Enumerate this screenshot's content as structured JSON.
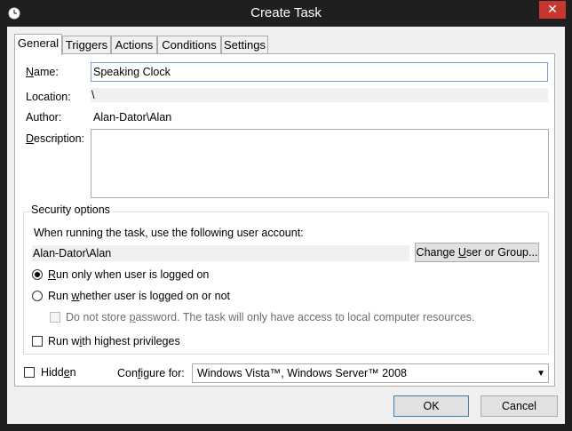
{
  "window": {
    "title": "Create Task",
    "close_glyph": "✕"
  },
  "tabs": [
    {
      "label": "General"
    },
    {
      "label": "Triggers"
    },
    {
      "label": "Actions"
    },
    {
      "label": "Conditions"
    },
    {
      "label": "Settings"
    }
  ],
  "general": {
    "name_label_u": "N",
    "name_label_rest": "ame:",
    "name_value": "Speaking Clock",
    "location_label": "Location:",
    "location_value": "\\",
    "author_label": "Author:",
    "author_value": "Alan-Dator\\Alan",
    "description_label_u": "D",
    "description_label_rest": "escription:"
  },
  "security": {
    "title": "Security options",
    "account_prompt": "When running the task, use the following user account:",
    "account_value": "Alan-Dator\\Alan",
    "change_button_pre": "Change ",
    "change_button_u": "U",
    "change_button_post": "ser or Group...",
    "radio_logged_on_u": "R",
    "radio_logged_on_rest": "un only when user is logged on",
    "radio_logged_on_selected": true,
    "radio_whether_pre": "Run ",
    "radio_whether_u": "w",
    "radio_whether_post": "hether user is logged on or not",
    "no_store_pre": "Do not store ",
    "no_store_u": "p",
    "no_store_post": "assword.  The task will only have access to local computer resources.",
    "highest_pre": "Run w",
    "highest_u": "i",
    "highest_post": "th highest privileges"
  },
  "bottom": {
    "hidden_pre": "Hidd",
    "hidden_u": "e",
    "hidden_post": "n",
    "configure_pre": "Con",
    "configure_u": "f",
    "configure_post": "igure for:",
    "configure_value": "Windows Vista™, Windows Server™ 2008"
  },
  "buttons": {
    "ok": "OK",
    "cancel": "Cancel"
  },
  "colors": {
    "titlebar": "#1f1f1f",
    "close": "#c7372f",
    "accent_border": "#7a9ed6"
  }
}
